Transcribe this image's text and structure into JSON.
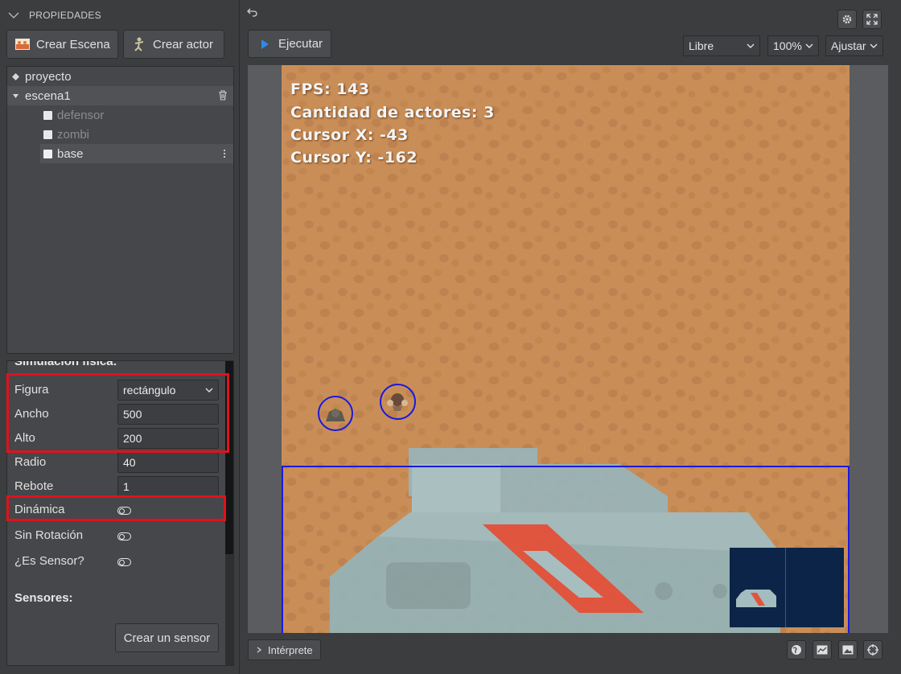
{
  "left_panel": {
    "header": "PROPIEDADES",
    "create_scene_label": "Crear Escena",
    "create_actor_label": "Crear actor",
    "tree": {
      "project": "proyecto",
      "scene": "escena1",
      "actors": [
        {
          "name": "defensor",
          "enabled": false
        },
        {
          "name": "zombi",
          "enabled": false
        },
        {
          "name": "base",
          "enabled": true,
          "selected": true
        }
      ]
    },
    "inspector": {
      "section_title": "Simulación física:",
      "fields": {
        "figura": {
          "label": "Figura",
          "value": "rectángulo"
        },
        "ancho": {
          "label": "Ancho",
          "value": "500"
        },
        "alto": {
          "label": "Alto",
          "value": "200"
        },
        "radio": {
          "label": "Radio",
          "value": "40"
        },
        "rebote": {
          "label": "Rebote",
          "value": "1"
        }
      },
      "toggles": {
        "dinamica": {
          "label": "Dinámica",
          "on": false
        },
        "sin_rotacion": {
          "label": "Sin Rotación",
          "on": false
        },
        "es_sensor": {
          "label": "¿Es Sensor?",
          "on": false
        }
      },
      "sensors_title": "Sensores:",
      "create_sensor_label": "Crear un sensor"
    }
  },
  "right_panel": {
    "run_label": "Ejecutar",
    "mode_select": "Libre",
    "zoom_select": "100%",
    "fit_select": "Ajustar",
    "hud": {
      "fps": "FPS: 143",
      "actors": "Cantidad de actores: 3",
      "cursor_x": "Cursor X: -43",
      "cursor_y": "Cursor Y: -162"
    },
    "interpreter_label": "Intérprete"
  },
  "colors": {
    "highlight_red": "#e0121b",
    "selection_blue": "#1a1adc",
    "play_blue": "#2d8ae8",
    "ground": "#c98e57"
  }
}
